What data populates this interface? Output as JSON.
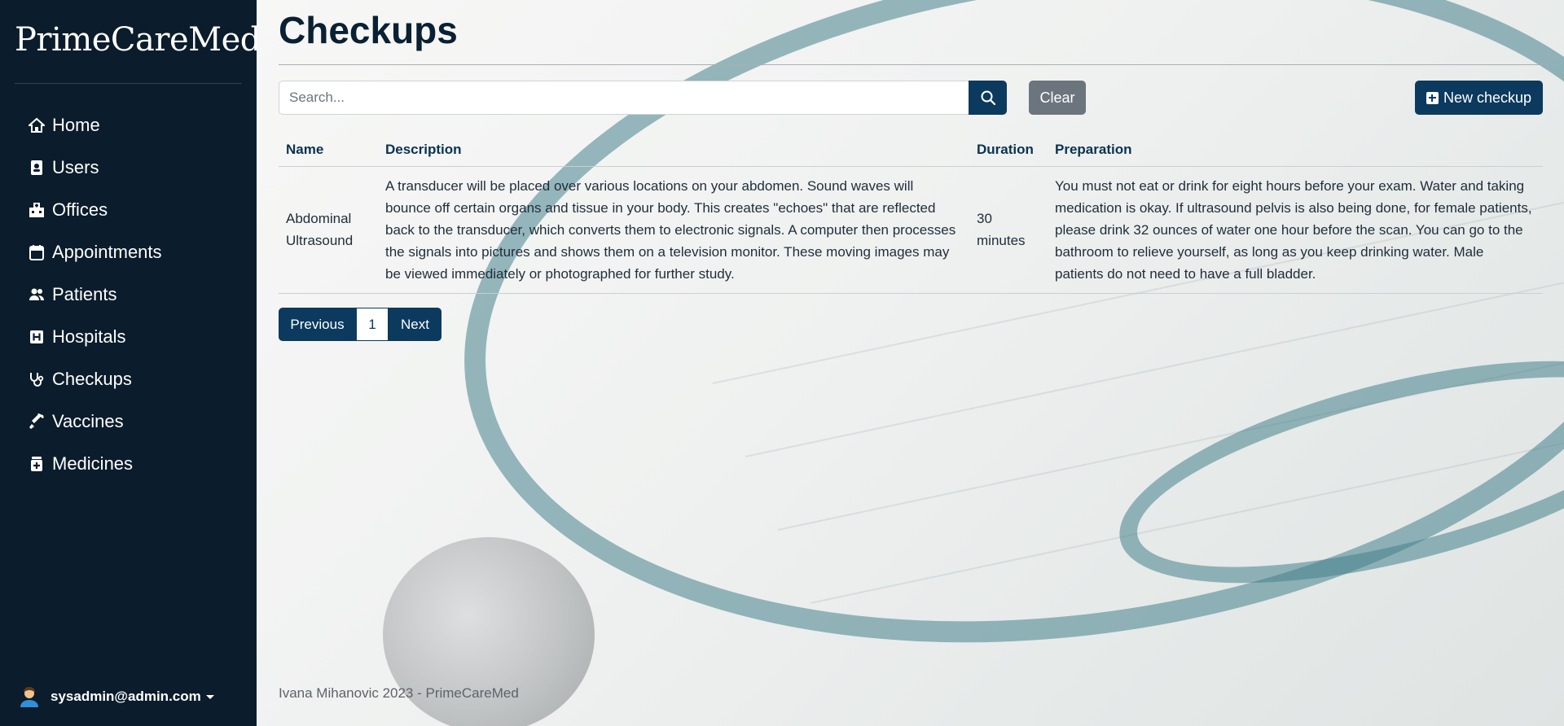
{
  "sidebar": {
    "brand": "PrimeCareMed",
    "items": [
      {
        "label": "Home",
        "icon": "home-icon"
      },
      {
        "label": "Users",
        "icon": "id-badge-icon"
      },
      {
        "label": "Offices",
        "icon": "hospital-building-icon"
      },
      {
        "label": "Appointments",
        "icon": "calendar-icon"
      },
      {
        "label": "Patients",
        "icon": "people-icon"
      },
      {
        "label": "Hospitals",
        "icon": "hospital-h-icon"
      },
      {
        "label": "Checkups",
        "icon": "stethoscope-icon"
      },
      {
        "label": "Vaccines",
        "icon": "syringe-icon"
      },
      {
        "label": "Medicines",
        "icon": "medicine-bottle-icon"
      }
    ],
    "user": "sysadmin@admin.com"
  },
  "main": {
    "title": "Checkups",
    "search": {
      "placeholder": "Search..."
    },
    "clear_label": "Clear",
    "new_label": "New checkup",
    "table": {
      "headers": [
        "Name",
        "Description",
        "Duration",
        "Preparation"
      ],
      "rows": [
        {
          "name": "Abdominal Ultrasound",
          "description": "A transducer will be placed over various locations on your abdomen. Sound waves will bounce off certain organs and tissue in your body. This creates \"echoes\" that are reflected back to the transducer, which converts them to electronic signals. A computer then processes the signals into pictures and shows them on a television monitor. These moving images may be viewed immediately or photographed for further study.",
          "duration": "30 minutes",
          "preparation": "You must not eat or drink for eight hours before your exam. Water and taking medication is okay. If ultrasound pelvis is also being done, for female patients, please drink 32 ounces of water one hour before the scan. You can go to the bathroom to relieve yourself, as long as you keep drinking water. Male patients do not need to have a full bladder."
        }
      ]
    },
    "pagination": {
      "previous": "Previous",
      "current": "1",
      "next": "Next"
    },
    "footer": "Ivana Mihanovic 2023 - PrimeCareMed"
  },
  "colors": {
    "sidebar_bg": "#0b1c2c",
    "primary": "#0b3a5e",
    "secondary": "#6c757d"
  }
}
